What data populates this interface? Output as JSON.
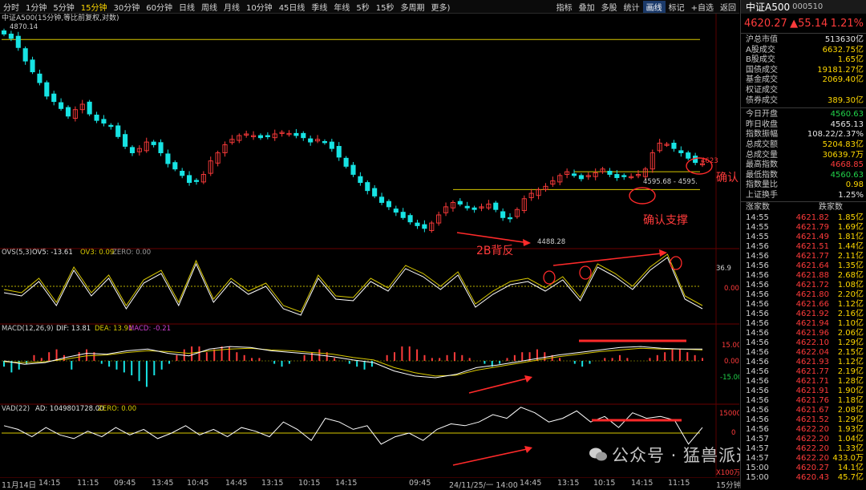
{
  "toolbar": {
    "left_items": [
      "分时",
      "1分钟",
      "5分钟",
      "15分钟",
      "30分钟",
      "60分钟",
      "日线",
      "周线",
      "月线",
      "10分钟",
      "45日线",
      "季线",
      "年线",
      "5秒",
      "15秒",
      "多周期",
      "更多)"
    ],
    "active": "15分钟",
    "right_items": [
      "指标",
      "叠加",
      "多股",
      "统计",
      "画线",
      "标记",
      "+自选",
      "返回"
    ],
    "right_active": "画线"
  },
  "main_chart": {
    "title": "中证A500(15分钟,等比前复权,对数)",
    "high_label": "4870.14",
    "low_label": "4488.28",
    "price_right_label": "4623",
    "range_label": "4595.68 - 4595.",
    "annotations": {
      "confirm": "确认",
      "confirm_support": "确认支撑",
      "b2": "2B背反"
    }
  },
  "ovs_panel": {
    "title": "OVS(5,3)",
    "ovs5_label": "OV5: -13.61",
    "ov3_label": "OV3: 0.09",
    "zero_label": "ZERO: 0.00",
    "axis_top": "36.9",
    "axis_zero": "0.00"
  },
  "macd_panel": {
    "title": "MACD(12,26,9)",
    "dif_label": "DIF: 13.81",
    "dea_label": "DEA: 13.91",
    "macd_label": "MACD: -0.21",
    "axis_pos": "15.00",
    "axis_zero": "0.00",
    "axis_neg": "-15.00"
  },
  "vad_panel": {
    "title": "VAD(22)",
    "ad_label": "AD: 1049801728.00",
    "zero_label": "ZERO: 0.00",
    "axis_top": "15000",
    "axis_zero": "0",
    "axis_unit": "X100万"
  },
  "time_axis": {
    "labels": [
      "11月14日",
      "14:15",
      "11:15",
      "09:45",
      "13:45",
      "10:45",
      "14:45",
      "13:15",
      "10:15",
      "14:15",
      "09:45",
      "24/11/25/一 14:00",
      "14:45",
      "13:15",
      "10:15",
      "14:15",
      "11:15"
    ],
    "period": "15分钟"
  },
  "side": {
    "name": "中证A500",
    "code": "000510",
    "price": "4620.27",
    "change": "▲55.14",
    "change_pct": "1.21%",
    "stats_a": [
      {
        "k": "沪总市值",
        "v": "513630亿",
        "c": ""
      },
      {
        "k": "A股成交",
        "v": "6632.75亿",
        "c": "yellow"
      },
      {
        "k": "B股成交",
        "v": "1.65亿",
        "c": "yellow"
      },
      {
        "k": "国债成交",
        "v": "19181.27亿",
        "c": "yellow"
      },
      {
        "k": "基金成交",
        "v": "2069.40亿",
        "c": "yellow"
      },
      {
        "k": "权证成交",
        "v": "",
        "c": ""
      },
      {
        "k": "债券成交",
        "v": "389.30亿",
        "c": "yellow"
      }
    ],
    "stats_b": [
      {
        "k": "今日开盘",
        "v": "4560.63",
        "c": "green"
      },
      {
        "k": "昨日收盘",
        "v": "4565.13",
        "c": ""
      },
      {
        "k": "指数振幅",
        "v": "108.22/2.37%",
        "c": ""
      },
      {
        "k": "总成交额",
        "v": "5204.83亿",
        "c": "yellow"
      },
      {
        "k": "总成交量",
        "v": "30639.7万",
        "c": "yellow"
      },
      {
        "k": "最高指数",
        "v": "4668.85",
        "c": "red"
      },
      {
        "k": "最低指数",
        "v": "4560.63",
        "c": "green"
      },
      {
        "k": "指数量比",
        "v": "0.98",
        "c": "yellow"
      },
      {
        "k": "上证换手",
        "v": "1.25%",
        "c": ""
      }
    ],
    "tick_header": {
      "a": "涨家数",
      "b": "跌家数"
    },
    "ticks": [
      {
        "t": "14:55",
        "p": "4621.82",
        "c": "1.85亿",
        "cc": "yellow"
      },
      {
        "t": "14:55",
        "p": "4621.79",
        "c": "1.69亿",
        "cc": "yellow"
      },
      {
        "t": "14:55",
        "p": "4621.49",
        "c": "1.81亿",
        "cc": "yellow"
      },
      {
        "t": "14:56",
        "p": "4621.51",
        "c": "1.44亿",
        "cc": "yellow"
      },
      {
        "t": "14:56",
        "p": "4621.77",
        "c": "2.11亿",
        "cc": "yellow"
      },
      {
        "t": "14:56",
        "p": "4621.64",
        "c": "1.35亿",
        "cc": "yellow"
      },
      {
        "t": "14:56",
        "p": "4621.88",
        "c": "2.68亿",
        "cc": "yellow"
      },
      {
        "t": "14:56",
        "p": "4621.72",
        "c": "1.08亿",
        "cc": "yellow"
      },
      {
        "t": "14:56",
        "p": "4621.80",
        "c": "2.20亿",
        "cc": "yellow"
      },
      {
        "t": "14:56",
        "p": "4621.66",
        "c": "1.12亿",
        "cc": "yellow"
      },
      {
        "t": "14:56",
        "p": "4621.92",
        "c": "2.16亿",
        "cc": "yellow"
      },
      {
        "t": "14:56",
        "p": "4621.94",
        "c": "1.10亿",
        "cc": "yellow"
      },
      {
        "t": "14:56",
        "p": "4621.96",
        "c": "2.06亿",
        "cc": "yellow"
      },
      {
        "t": "14:56",
        "p": "4622.10",
        "c": "1.29亿",
        "cc": "yellow"
      },
      {
        "t": "14:56",
        "p": "4622.04",
        "c": "2.15亿",
        "cc": "yellow"
      },
      {
        "t": "14:56",
        "p": "4621.93",
        "c": "1.12亿",
        "cc": "yellow"
      },
      {
        "t": "14:56",
        "p": "4621.77",
        "c": "2.19亿",
        "cc": "yellow"
      },
      {
        "t": "14:56",
        "p": "4621.71",
        "c": "1.28亿",
        "cc": "yellow"
      },
      {
        "t": "14:56",
        "p": "4621.91",
        "c": "1.90亿",
        "cc": "yellow"
      },
      {
        "t": "14:56",
        "p": "4621.76",
        "c": "1.18亿",
        "cc": "yellow"
      },
      {
        "t": "14:56",
        "p": "4621.67",
        "c": "2.08亿",
        "cc": "yellow"
      },
      {
        "t": "14:56",
        "p": "4621.52",
        "c": "1.29亿",
        "cc": "yellow"
      },
      {
        "t": "14:56",
        "p": "4622.20",
        "c": "1.93亿",
        "cc": "yellow"
      },
      {
        "t": "14:57",
        "p": "4622.20",
        "c": "1.04亿",
        "cc": "yellow"
      },
      {
        "t": "14:57",
        "p": "4622.20",
        "c": "1.33亿",
        "cc": "yellow"
      },
      {
        "t": "14:57",
        "p": "4622.20",
        "c": "433.0万",
        "cc": "yellow"
      },
      {
        "t": "15:00",
        "p": "4620.27",
        "c": "14.1亿",
        "cc": "yellow"
      },
      {
        "t": "15:00",
        "p": "4620.43",
        "c": "45.7亿",
        "cc": "yellow"
      }
    ]
  },
  "watermark": "公众号 · 猛兽派选股",
  "colors": {
    "up": "#ff3b3b",
    "down": "#17e3e3",
    "level": "#d8c800",
    "arrow": "#ff2a2a",
    "dif": "#ffffff",
    "dea": "#d8c800",
    "macd_pos": "#ff3b3b",
    "macd_neg": "#17e3e3"
  },
  "chart_data": [
    {
      "type": "candlestick",
      "title": "中证A500(15分钟,等比前复权,对数)",
      "close_path": [
        4860,
        4852,
        4835,
        4810,
        4790,
        4770,
        4745,
        4735,
        4722,
        4708,
        4720,
        4730,
        4712,
        4700,
        4695,
        4690,
        4670,
        4652,
        4640,
        4648,
        4660,
        4655,
        4640,
        4620,
        4610,
        4598,
        4585,
        4588,
        4600,
        4625,
        4640,
        4655,
        4665,
        4672,
        4675,
        4672,
        4668,
        4670,
        4675,
        4678,
        4676,
        4672,
        4668,
        4660,
        4665,
        4660,
        4648,
        4632,
        4615,
        4600,
        4585,
        4570,
        4560,
        4548,
        4540,
        4530,
        4520,
        4512,
        4505,
        4500,
        4510,
        4525,
        4540,
        4548,
        4545,
        4538,
        4535,
        4540,
        4545,
        4535,
        4520,
        4518,
        4535,
        4555,
        4565,
        4572,
        4578,
        4588,
        4598,
        4605,
        4598,
        4592,
        4598,
        4603,
        4610,
        4600,
        4594,
        4597,
        4596,
        4600,
        4610,
        4640,
        4658,
        4656,
        4648,
        4640,
        4630,
        4622,
        4620
      ],
      "levels": [
        4850,
        4605,
        4600,
        4572,
        4585
      ],
      "high_label": 4870.14,
      "low_label": 4488.28
    },
    {
      "type": "line",
      "title": "OVS(5,3)",
      "series": [
        {
          "name": "OV5",
          "values": [
            -4,
            -6,
            3,
            -12,
            10,
            -6,
            5,
            -14,
            2,
            8,
            -12,
            14,
            -10,
            3,
            -5,
            0,
            -14,
            -18,
            5,
            -8,
            -9,
            3,
            -3,
            11,
            6,
            -2,
            7,
            -13,
            -5,
            1,
            3,
            -3,
            4,
            -9,
            12,
            6,
            -2,
            10,
            18,
            -8,
            -14
          ]
        },
        {
          "name": "OV3",
          "values": [
            -2,
            -4,
            5,
            -10,
            12,
            -4,
            7,
            -12,
            4,
            10,
            -10,
            16,
            -8,
            5,
            -3,
            2,
            -12,
            -16,
            7,
            -6,
            -7,
            5,
            -1,
            13,
            8,
            0,
            9,
            -11,
            -3,
            3,
            5,
            -1,
            6,
            -7,
            14,
            8,
            0,
            12,
            20,
            -6,
            -12
          ]
        }
      ],
      "zero": 0
    },
    {
      "type": "bar",
      "title": "MACD(12,26,9)",
      "series": [
        {
          "name": "DIF",
          "values": [
            0,
            -4,
            -2,
            4,
            9,
            8,
            12,
            14,
            9,
            6,
            14,
            17,
            16,
            12,
            10,
            8,
            5,
            1,
            -2,
            -12,
            -18,
            -20,
            -16,
            -8,
            -5,
            -1,
            3,
            7,
            10,
            13,
            16,
            17,
            15,
            14,
            14
          ]
        },
        {
          "name": "DEA",
          "values": [
            -1,
            -2,
            -1,
            2,
            6,
            7,
            10,
            12,
            11,
            9,
            12,
            14,
            15,
            13,
            12,
            10,
            8,
            4,
            1,
            -8,
            -14,
            -18,
            -17,
            -11,
            -7,
            -3,
            1,
            5,
            8,
            11,
            13,
            15,
            14,
            14,
            13
          ]
        }
      ],
      "histogram": [
        -2,
        -4,
        -3,
        -1,
        2,
        1,
        3,
        4,
        2,
        -3,
        3,
        4,
        3,
        -1,
        -2,
        -3,
        -4,
        -5,
        -7,
        -9,
        -5,
        -3,
        -1,
        2,
        4,
        5,
        5,
        3,
        4,
        5,
        5,
        3,
        2,
        1,
        1,
        0,
        -1,
        -2,
        -1,
        0,
        2,
        3,
        4,
        3,
        1,
        0,
        -1,
        -2,
        -3,
        -2,
        0,
        2,
        3,
        5,
        5,
        4,
        2,
        1,
        1,
        2,
        3,
        2,
        1,
        0,
        -1,
        -2,
        -1,
        1,
        2,
        3,
        3,
        4,
        3,
        2,
        1,
        0,
        -1,
        -2,
        -1,
        0,
        1,
        1,
        2,
        1,
        0,
        0,
        1,
        2,
        3,
        4,
        4,
        3,
        2,
        1
      ],
      "axis": [
        -15,
        0,
        15
      ]
    },
    {
      "type": "line",
      "title": "VAD(22)",
      "series": [
        {
          "name": "AD",
          "values": [
            4,
            2,
            -2,
            3,
            -1,
            -3,
            1,
            -2,
            3,
            -1,
            2,
            -3,
            0,
            4,
            -1,
            2,
            -2,
            3,
            1,
            -2,
            6,
            2,
            -4,
            8,
            6,
            2,
            4,
            -6,
            -2,
            0,
            -4,
            2,
            5,
            4,
            6,
            10,
            8,
            14,
            11,
            6,
            8,
            12,
            6,
            9,
            3,
            11,
            8,
            9,
            7,
            -6,
            3
          ]
        }
      ],
      "zero": 0,
      "axis": [
        0,
        15000
      ],
      "unit": "X100万"
    }
  ]
}
